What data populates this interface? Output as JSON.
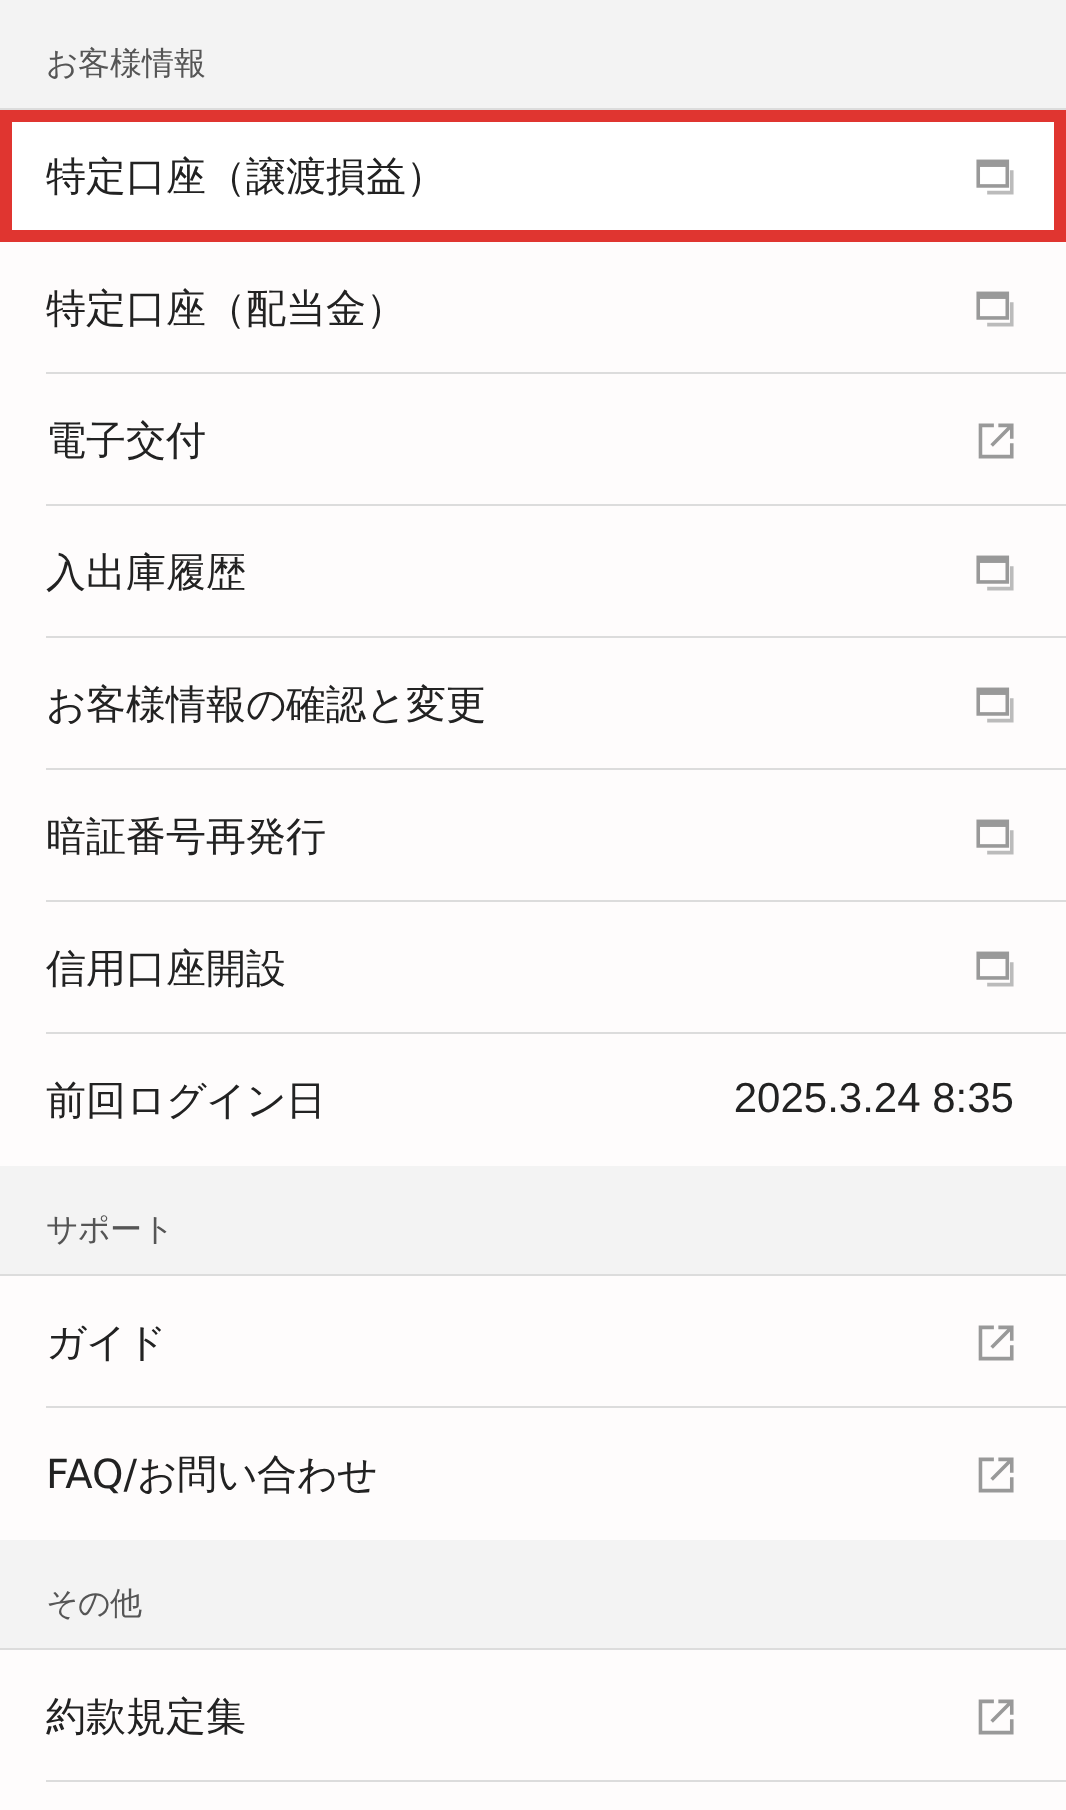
{
  "sections": [
    {
      "title": "お客様情報",
      "items": [
        {
          "label": "特定口座（譲渡損益）",
          "kind": "window",
          "highlighted": true
        },
        {
          "label": "特定口座（配当金）",
          "kind": "window",
          "highlighted": false
        },
        {
          "label": "電子交付",
          "kind": "external",
          "highlighted": false
        },
        {
          "label": "入出庫履歴",
          "kind": "window",
          "highlighted": false
        },
        {
          "label": "お客様情報の確認と変更",
          "kind": "window",
          "highlighted": false
        },
        {
          "label": "暗証番号再発行",
          "kind": "window",
          "highlighted": false
        },
        {
          "label": "信用口座開設",
          "kind": "window",
          "highlighted": false
        },
        {
          "label": "前回ログイン日",
          "kind": "info",
          "value": "2025.3.24 8:35",
          "highlighted": false
        }
      ]
    },
    {
      "title": "サポート",
      "items": [
        {
          "label": "ガイド",
          "kind": "external",
          "highlighted": false
        },
        {
          "label": "FAQ/お問い合わせ",
          "kind": "external",
          "highlighted": false
        }
      ]
    },
    {
      "title": "その他",
      "items": [
        {
          "label": "約款規定集",
          "kind": "external",
          "highlighted": false
        }
      ]
    }
  ]
}
